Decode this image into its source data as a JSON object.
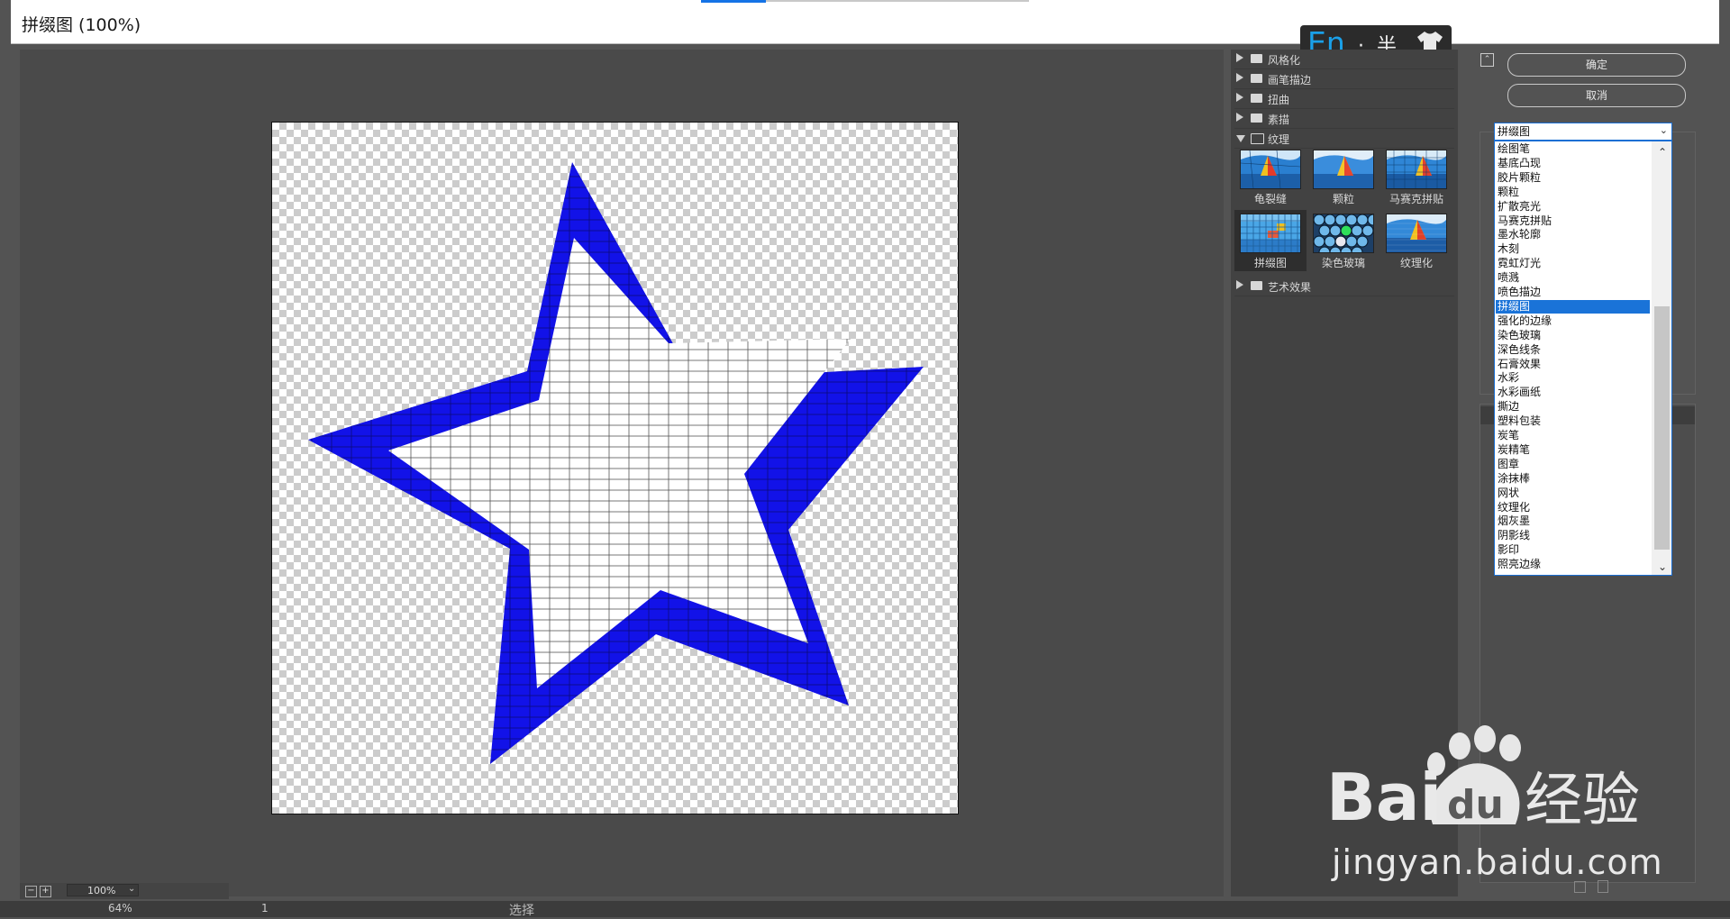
{
  "window": {
    "title": "拼缀图 (100%)"
  },
  "ime": {
    "lang": "En",
    "status": "·, 半",
    "icon": "shirt-icon"
  },
  "preview": {
    "zoom_value": "100%",
    "zoom_out_label": "−",
    "zoom_in_label": "+"
  },
  "filter_gallery": {
    "categories_top": [
      "风格化",
      "画笔描边",
      "扭曲",
      "素描"
    ],
    "open_category": "纹理",
    "thumbnails": [
      "龟裂缝",
      "颗粒",
      "马赛克拼贴",
      "拼缀图",
      "染色玻璃",
      "纹理化"
    ],
    "selected_thumbnail": "拼缀图",
    "categories_bottom": [
      "艺术效果"
    ]
  },
  "buttons": {
    "ok": "确定",
    "cancel": "取消"
  },
  "filter_select": {
    "value": "拼缀图",
    "options": [
      "绘图笔",
      "基底凸现",
      "胶片颗粒",
      "颗粒",
      "扩散亮光",
      "马赛克拼贴",
      "墨水轮廓",
      "木刻",
      "霓虹灯光",
      "喷溅",
      "喷色描边",
      "拼缀图",
      "强化的边缘",
      "染色玻璃",
      "深色线条",
      "石膏效果",
      "水彩",
      "水彩画纸",
      "撕边",
      "塑料包装",
      "炭笔",
      "炭精笔",
      "图章",
      "涂抹棒",
      "网状",
      "纹理化",
      "烟灰墨",
      "阴影线",
      "影印",
      "照亮边缘"
    ],
    "selected_index": 11
  },
  "watermark": {
    "brand": "Bai",
    "brand_suffix": "经验",
    "url": "jingyan.baidu.com"
  },
  "bottom_strip": {
    "zoom": "64%",
    "page": "1",
    "mid_text": "选择"
  },
  "colors": {
    "accent": "#1473e6",
    "star": "#1212e8",
    "selection": "#1a73d8"
  }
}
